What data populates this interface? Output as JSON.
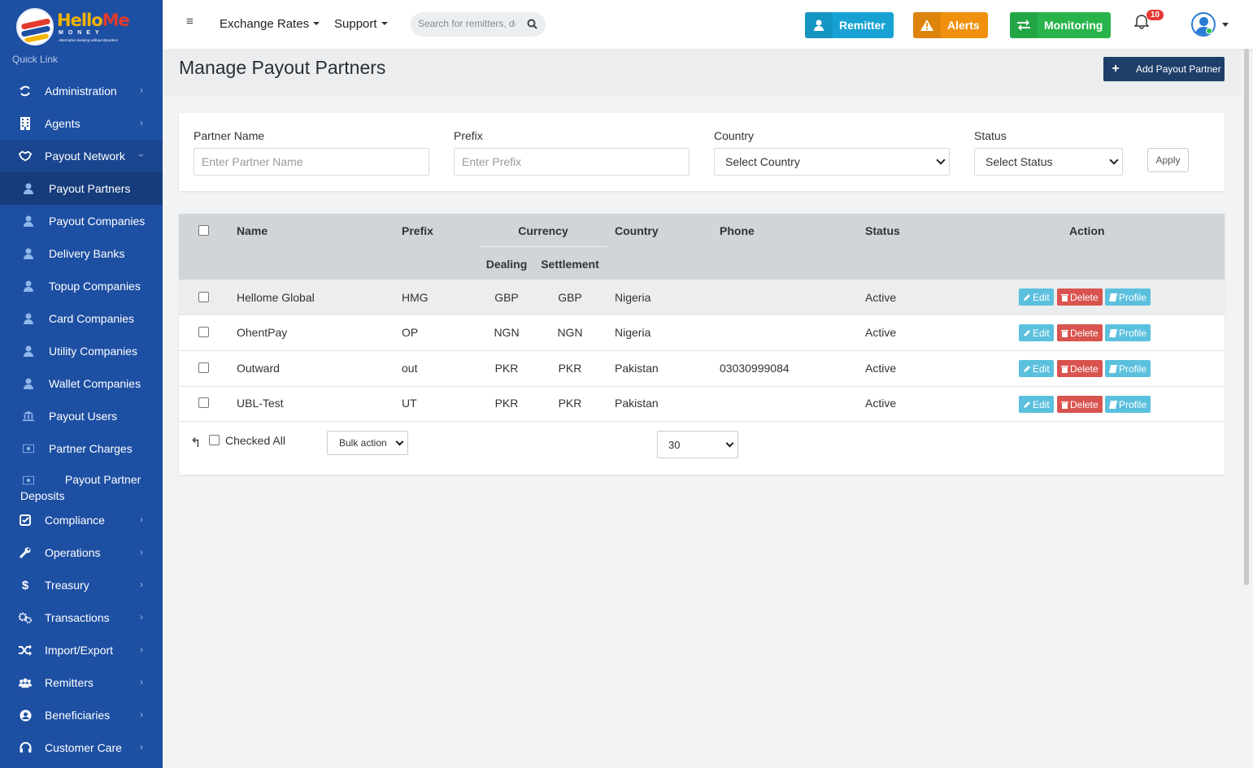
{
  "brand": {
    "name_a": "Hello",
    "name_b": "Me",
    "sub": "MONEY",
    "tagline": "Alternative banking without Boarders"
  },
  "sidebar": {
    "quick_link": "Quick Link",
    "items": [
      {
        "label": "Administration",
        "icon": "sync-icon"
      },
      {
        "label": "Agents",
        "icon": "building-icon"
      },
      {
        "label": "Payout Network",
        "icon": "handshake-icon"
      }
    ],
    "sub_items": [
      {
        "label": "Payout Partners",
        "icon": "user-icon"
      },
      {
        "label": "Payout Companies",
        "icon": "user-icon"
      },
      {
        "label": "Delivery Banks",
        "icon": "user-icon"
      },
      {
        "label": "Topup Companies",
        "icon": "user-icon"
      },
      {
        "label": "Card Companies",
        "icon": "user-icon"
      },
      {
        "label": "Utility Companies",
        "icon": "user-icon"
      },
      {
        "label": "Wallet Companies",
        "icon": "user-icon"
      },
      {
        "label": "Payout Users",
        "icon": "bank-icon"
      },
      {
        "label": "Partner Charges",
        "icon": "money-icon"
      },
      {
        "label": "Payout Partner Deposits",
        "icon": "money-icon"
      }
    ],
    "bottom_items": [
      {
        "label": "Compliance",
        "icon": "check-square-icon"
      },
      {
        "label": "Operations",
        "icon": "wrench-icon"
      },
      {
        "label": "Treasury",
        "icon": "dollar-icon"
      },
      {
        "label": "Transactions",
        "icon": "cogs-icon"
      },
      {
        "label": "Import/Export",
        "icon": "shuffle-icon"
      },
      {
        "label": "Remitters",
        "icon": "users-icon"
      },
      {
        "label": "Beneficiaries",
        "icon": "user-circle-icon"
      },
      {
        "label": "Customer Care",
        "icon": "headset-icon"
      }
    ]
  },
  "topbar": {
    "exchange_rates": "Exchange Rates",
    "support": "Support",
    "search_placeholder": "Search for remitters, do",
    "remitter": "Remitter",
    "alerts": "Alerts",
    "monitoring": "Monitoring",
    "notif_count": "10",
    "colors": {
      "remitter": "#17a2d3",
      "alerts": "#f0900f",
      "monitoring": "#28b44b"
    }
  },
  "page": {
    "title": "Manage Payout Partners",
    "add_button": "Add Payout Partner"
  },
  "filters": {
    "partner_label": "Partner Name",
    "partner_placeholder": "Enter Partner Name",
    "prefix_label": "Prefix",
    "prefix_placeholder": "Enter Prefix",
    "country_label": "Country",
    "country_value": "Select Country",
    "status_label": "Status",
    "status_value": "Select Status",
    "apply": "Apply"
  },
  "table": {
    "headers": {
      "name": "Name",
      "prefix": "Prefix",
      "currency": "Currency",
      "dealing": "Dealing",
      "settlement": "Settlement",
      "country": "Country",
      "phone": "Phone",
      "status": "Status",
      "action": "Action"
    },
    "rows": [
      {
        "name": "Hellome Global",
        "prefix": "HMG",
        "dealing": "GBP",
        "settlement": "GBP",
        "country": "Nigeria",
        "phone": "",
        "status": "Active"
      },
      {
        "name": "OhentPay",
        "prefix": "OP",
        "dealing": "NGN",
        "settlement": "NGN",
        "country": "Nigeria",
        "phone": "",
        "status": "Active"
      },
      {
        "name": "Outward",
        "prefix": "out",
        "dealing": "PKR",
        "settlement": "PKR",
        "country": "Pakistan",
        "phone": "03030999084",
        "status": "Active"
      },
      {
        "name": "UBL-Test",
        "prefix": "UT",
        "dealing": "PKR",
        "settlement": "PKR",
        "country": "Pakistan",
        "phone": "",
        "status": "Active"
      }
    ],
    "actions": {
      "edit": "Edit",
      "delete": "Delete",
      "profile": "Profile"
    },
    "footer": {
      "checked_all": "Checked All",
      "bulk_action": "Bulk action",
      "page_size": "30"
    }
  }
}
